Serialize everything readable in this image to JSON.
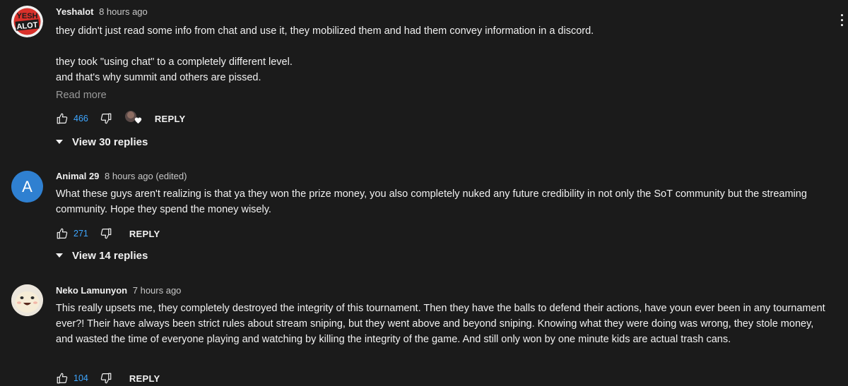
{
  "comments": [
    {
      "author": "Yeshalot",
      "time": "8 hours ago",
      "paragraphs": [
        "they didn't just read some info from chat and use it, they mobilized them and had them convey information in a discord.",
        "",
        "they took \"using chat\" to a completely different level.",
        "and that's why summit and others are pissed."
      ],
      "read_more": "Read more",
      "likes": "466",
      "reply_label": "REPLY",
      "view_replies": "View 30 replies",
      "avatar_text": "YESH ALOT",
      "avatar_color": "#d9312b"
    },
    {
      "author": "Animal 29",
      "time": "8 hours ago (edited)",
      "paragraphs": [
        "What these guys aren't realizing is that ya they won the prize money, you also completely nuked any future credibility in not only the SoT community but the streaming community. Hope they spend the money wisely."
      ],
      "likes": "271",
      "reply_label": "REPLY",
      "view_replies": "View 14 replies",
      "avatar_letter": "A",
      "avatar_color": "#2f80d1"
    },
    {
      "author": "Neko Lamunyon",
      "time": "7 hours ago",
      "paragraphs": [
        "This really upsets me, they completely destroyed the integrity of this tournament. Then they have the balls to defend their actions, have youn ever been in any tournament ever?! Their have always been strict rules about stream sniping, but they went above and beyond sniping. Knowing what they were doing was wrong, they stole money, and wasted the time of everyone playing and watching by killing the integrity of the game. And still only won by one minute kids are actual trash cans."
      ],
      "likes": "104",
      "reply_label": "REPLY"
    }
  ],
  "icons": {
    "like": "thumbs-up-icon",
    "dislike": "thumbs-down-icon",
    "creator_heart": "creator-heart-icon",
    "expand": "triangle-down-icon",
    "more": "more-vert-icon"
  },
  "colors": {
    "background": "#1b1b1b",
    "like_count": "#3ea6ff",
    "muted_text": "#9a9a9a"
  }
}
